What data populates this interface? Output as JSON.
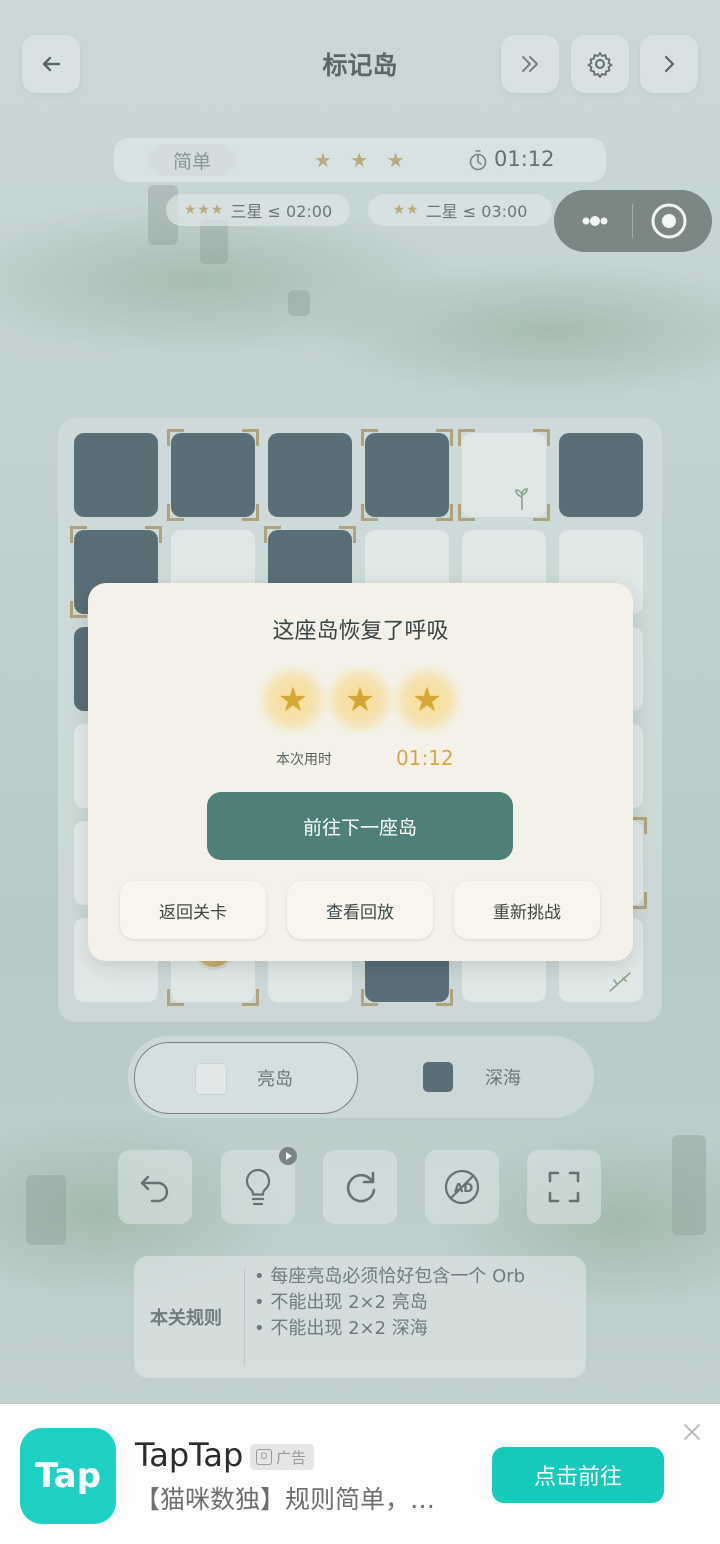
{
  "header": {
    "back_icon": "arrow-left-icon",
    "title": "标记岛",
    "skip_icon": "double-chevron-right-icon",
    "settings_icon": "gear-icon",
    "next_icon": "chevron-right-icon"
  },
  "status": {
    "difficulty": "简单",
    "stars": "★ ★ ★",
    "timer_icon": "stopwatch-icon",
    "time": "01:12"
  },
  "goals": [
    {
      "stars": "★★★",
      "text": "三星 ≤ 02:00"
    },
    {
      "stars": "★★",
      "text": "二星 ≤ 03:00"
    }
  ],
  "capsule": {
    "more_icon": "more-dots-icon",
    "close_icon": "target-circle-icon"
  },
  "modal": {
    "title": "这座岛恢复了呼吸",
    "star_count": 3,
    "time_label": "本次用时",
    "time_value": "01:12",
    "primary_button": "前往下一座岛",
    "buttons": [
      "返回关卡",
      "查看回放",
      "重新挑战"
    ]
  },
  "legend": {
    "items": [
      "亮岛",
      "深海"
    ],
    "selected": "亮岛"
  },
  "tools": [
    "undo-icon",
    "lightbulb-hint-icon",
    "redo-icon",
    "no-ads-icon",
    "fullscreen-icon"
  ],
  "rules": {
    "label": "本关规则",
    "items": [
      "每座亮岛必须恰好包含一个 Orb",
      "不能出现 2×2 亮岛",
      "不能出现 2×2 深海"
    ]
  },
  "ad": {
    "logo_text": "Tap",
    "app_name": "TapTap",
    "ad_badge": "广告",
    "description": "【猫咪数独】规则简单，…",
    "cta": "点击前往",
    "close_icon": "close-icon"
  },
  "colors": {
    "deep_sea": "#2c4350",
    "bright_island": "#e7eceb",
    "accent": "#4e7f78",
    "marker": "#a68c52",
    "ad_cta": "#15c9bb"
  }
}
